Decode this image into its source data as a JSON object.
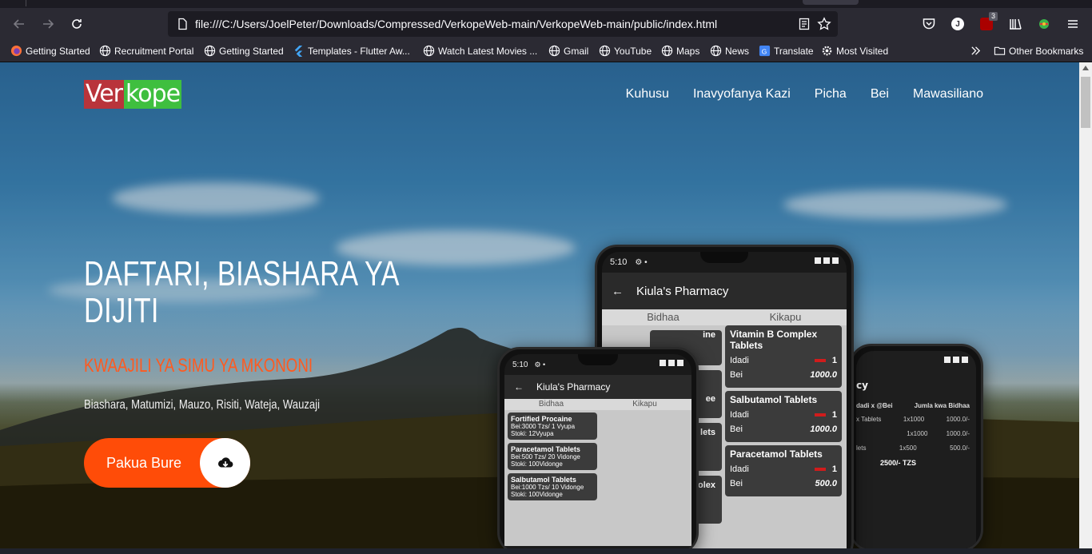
{
  "browser": {
    "url": "file:///C:/Users/JoelPeter/Downloads/Compressed/VerkopeWeb-main/VerkopeWeb-main/public/index.html",
    "account_initial": "J",
    "extension_badge": "3",
    "bookmarks": [
      {
        "label": "Getting Started",
        "icon": "firefox-icon"
      },
      {
        "label": "Recruitment Portal",
        "icon": "globe-icon"
      },
      {
        "label": "Getting Started",
        "icon": "globe-icon"
      },
      {
        "label": "Templates - Flutter Aw...",
        "icon": "flutter-icon"
      },
      {
        "label": "Watch Latest Movies ...",
        "icon": "globe-icon"
      },
      {
        "label": "Gmail",
        "icon": "globe-icon"
      },
      {
        "label": "YouTube",
        "icon": "globe-icon"
      },
      {
        "label": "Maps",
        "icon": "globe-icon"
      },
      {
        "label": "News",
        "icon": "globe-icon"
      },
      {
        "label": "Translate",
        "icon": "translate-icon"
      },
      {
        "label": "Most Visited",
        "icon": "gear-icon"
      }
    ],
    "other_bookmarks": "Other Bookmarks"
  },
  "site": {
    "logo_part1": "Ver",
    "logo_part2": "kope",
    "nav": [
      "Kuhusu",
      "Inavyofanya Kazi",
      "Picha",
      "Bei",
      "Mawasiliano"
    ],
    "hero_title": "DAFTARI, BIASHARA YA DIJITI",
    "hero_subtitle": "KWAAJILI YA SIMU YA MKONONI",
    "hero_tags": "Biashara, Matumizi, Mauzo, Risiti, Wateja, Wauzaji",
    "cta_label": "Pakua Bure"
  },
  "phone_main": {
    "time": "5:10",
    "title": "Kiula's Pharmacy",
    "tab_products": "Bidhaa",
    "tab_cart": "Kikapu",
    "cart": [
      {
        "name": "Vitamin B Complex Tablets",
        "qty_label": "Idadi",
        "qty": "1",
        "price_label": "Bei",
        "price": "1000.0"
      },
      {
        "name": "Salbutamol Tablets",
        "qty_label": "Idadi",
        "qty": "1",
        "price_label": "Bei",
        "price": "1000.0"
      },
      {
        "name": "Paracetamol Tablets",
        "qty_label": "Idadi",
        "qty": "1",
        "price_label": "Bei",
        "price": "500.0"
      }
    ],
    "left_fragments": [
      "ine",
      "ee",
      "lets",
      "ge",
      "olex",
      "nge"
    ]
  },
  "phone_front": {
    "time": "5:10",
    "title": "Kiula's Pharmacy",
    "tab_products": "Bidhaa",
    "tab_cart": "Kikapu",
    "products": [
      {
        "name": "Fortified Procaine",
        "line1": "Bei:3000 Tzs/ 1 Vyupa",
        "line2": "Stoki: 12Vyupa"
      },
      {
        "name": "Paracetamol Tablets",
        "line1": "Bei:500 Tzs/ 20 Vidonge",
        "line2": "Stoki: 100Vidonge"
      },
      {
        "name": "Salbutamol Tablets",
        "line1": "Bei:1000 Tzs/ 10 Vidonge",
        "line2": "Stoki: 100Vidonge"
      }
    ]
  },
  "phone_back": {
    "title_fragment": "cy",
    "col1": "dadi x @Bei",
    "col2": "Jumla kwa Bidhaa",
    "rows": [
      {
        "a": "x Tablets",
        "b": "1x1000",
        "c": "1000.0/-"
      },
      {
        "a": "",
        "b": "1x1000",
        "c": "1000.0/-"
      },
      {
        "a": "lets",
        "b": "1x500",
        "c": "500.0/-"
      }
    ],
    "total": "2500/- TZS"
  }
}
